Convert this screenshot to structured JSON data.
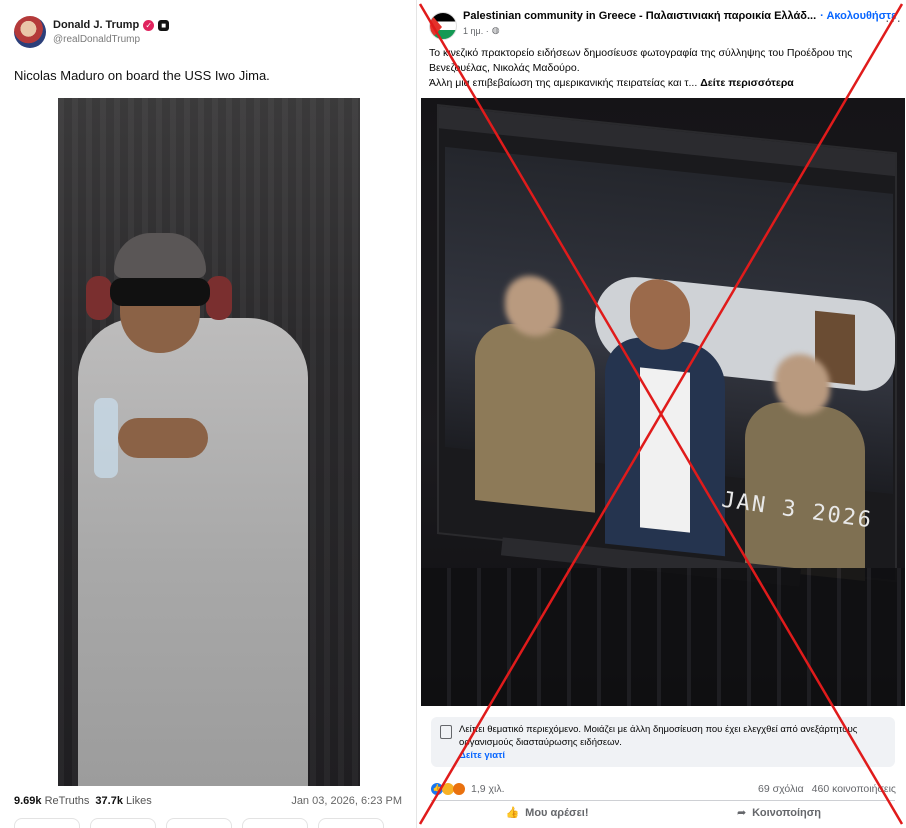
{
  "truth_post": {
    "author_name": "Donald J. Trump",
    "handle": "@realDonaldTrump",
    "text": "Nicolas Maduro on board the USS Iwo Jima.",
    "retruths_count": "9.69k",
    "retruths_label": "ReTruths",
    "likes_count": "37.7k",
    "likes_label": "Likes",
    "date": "Jan 03, 2026, 6:23 PM"
  },
  "facebook_post": {
    "page_name": "Palestinian community in Greece - Παλαιστινιακή παροικία Ελλάδ...",
    "follow_label": "· Ακολουθήστε",
    "time": "1 ημ. ·",
    "text_line1": "Το κινεζικό πρακτορείο ειδήσεων δημοσίευσε φωτογραφία της σύλληψης του Προέδρου της Βενεζουέλας, Νικολάς Μαδούρο.",
    "text_line2": "Άλλη μια επιβεβαίωση της αμερικανικής πειρατείας και τ...",
    "see_more": "Δείτε περισσότερα",
    "photo_datestamp": "JAN 3 2026",
    "notice_text": "Λείπει θεματικό περιεχόμενο. Μοιάζει με άλλη δημοσίευση που έχει ελεγχθεί από ανεξάρτητους οργανισμούς διασταύρωσης ειδήσεων.",
    "notice_link": "Δείτε γιατί",
    "reactions_count": "1,9 χιλ.",
    "comments": "69 σχόλια",
    "shares": "460 κοινοποιήσεις",
    "like_button": "Μου αρέσει!",
    "share_button": "Κοινοποίηση"
  },
  "overlay": {
    "cross_color": "#e01b1b"
  }
}
